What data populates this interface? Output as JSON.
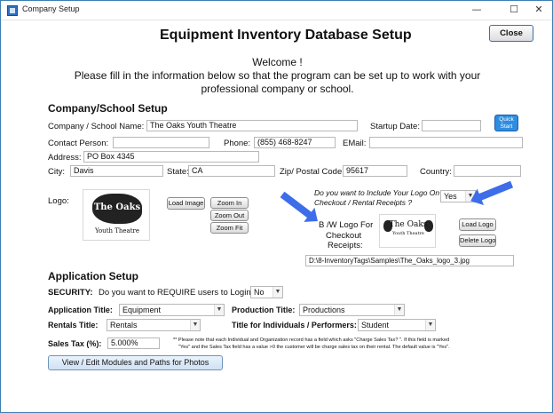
{
  "window": {
    "title": "Company Setup",
    "minimize": "—",
    "maximize": "☐",
    "close": "✕"
  },
  "header": {
    "title": "Equipment Inventory Database Setup",
    "close_button": "Close",
    "welcome_line1": "Welcome !",
    "welcome_line2": "Please fill in the information below so that the program can be set up to work with your",
    "welcome_line3": "professional company or school."
  },
  "company": {
    "heading": "Company/School Setup",
    "name_label": "Company / School Name:",
    "name_value": "The Oaks Youth Theatre",
    "startup_label": "Startup Date:",
    "startup_value": "",
    "quick_start": "Quick Start",
    "contact_label": "Contact Person:",
    "contact_value": "",
    "phone_label": "Phone:",
    "phone_value": "(855) 468-8247",
    "email_label": "EMail:",
    "email_value": "",
    "address_label": "Address:",
    "address_value": "PO Box 4345",
    "city_label": "City:",
    "city_value": "Davis",
    "state_label": "State:",
    "state_value": "CA",
    "zip_label": "Zip/ Postal Code:",
    "zip_value": "95617",
    "country_label": "Country:",
    "country_value": "",
    "logo_label": "Logo:",
    "load_image": "Load Image",
    "zoom_in": "Zoom In",
    "zoom_out": "Zoom Out",
    "zoom_fit": "Zoom Fit",
    "include_logo_q1": "Do you want to Include Your Logo On",
    "include_logo_q2": "Checkout / Rental Receipts ?",
    "include_logo_value": "Yes",
    "bw_logo_label1": "B /W Logo For",
    "bw_logo_label2": "Checkout",
    "bw_logo_label3": "Receipts:",
    "load_logo": "Load Logo",
    "delete_logo": "Delete Logo",
    "logo_path": "D:\\8-InventoryTags\\Samples\\The_Oaks_logo_3.jpg",
    "logo_text_main": "The Oaks",
    "logo_text_sub": "Youth Theatre"
  },
  "app": {
    "heading": "Application Setup",
    "security_label": "SECURITY:",
    "security_q": "Do you want to REQUIRE users to Login ?",
    "security_value": "No",
    "app_title_label": "Application Title:",
    "app_title_value": "Equipment",
    "production_label": "Production Title:",
    "production_value": "Productions",
    "rentals_label": "Rentals Title:",
    "rentals_value": "Rentals",
    "individuals_label": "Title for Individuals / Performers:",
    "individuals_value": "Student",
    "sales_tax_label": "Sales Tax (%):",
    "sales_tax_value": "5.000%",
    "note1": "** Please note that each Individual and Organization record has a field which asks \"Charge Sales Tax? \". If this field is marked",
    "note2": "\"Yes\" and the Sales Tax field has a value >0 the customer will be charge sales tax on their rental. The default value is \"Yes\".",
    "modules_button": "View / Edit Modules and Paths for Photos"
  },
  "colors": {
    "arrow": "#3d6de8",
    "quick_start": "#2e8de0",
    "window_border": "#3c7fb1"
  }
}
